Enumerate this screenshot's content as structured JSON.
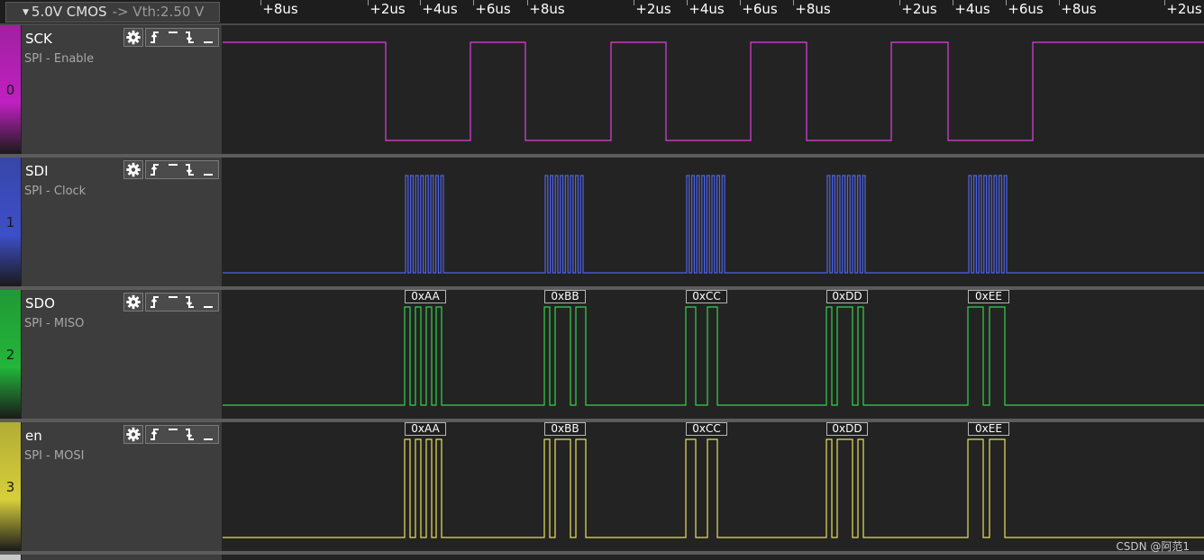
{
  "topbar": {
    "voltage_text": "5.0V CMOS",
    "vth_text": "-> Vth:2.50 V",
    "ruler_labels": [
      "+8us",
      "+2us",
      "+4us",
      "+6us",
      "+8us",
      "+2us",
      "+4us",
      "+6us",
      "+8us",
      "+2us",
      "+4us",
      "+6us",
      "+8us",
      "+2us"
    ]
  },
  "channels": [
    {
      "number": "0",
      "name": "SCK",
      "description": "SPI - Enable",
      "color": "#e040e0",
      "strip_color": "#c020c0",
      "decoded": [],
      "signal_kind": "enable",
      "idle_level": 1
    },
    {
      "number": "1",
      "name": "SDI",
      "description": "SPI - Clock",
      "color": "#4f63e6",
      "strip_color": "#3d4fc9",
      "decoded": [],
      "signal_kind": "clock",
      "idle_level": 0
    },
    {
      "number": "2",
      "name": "SDO",
      "description": "SPI - MISO",
      "color": "#33d44a",
      "strip_color": "#22b63a",
      "decoded": [
        "0xAA",
        "0xBB",
        "0xCC",
        "0xDD",
        "0xEE"
      ],
      "signal_kind": "data",
      "idle_level": 0
    },
    {
      "number": "3",
      "name": "en",
      "description": "SPI - MOSI",
      "color": "#e8e25a",
      "strip_color": "#d6cf3a",
      "decoded": [
        "0xAA",
        "0xBB",
        "0xCC",
        "0xDD",
        "0xEE"
      ],
      "signal_kind": "data",
      "idle_level": 0
    }
  ],
  "icons": {
    "gear": "gear-icon",
    "trigger": [
      "rising-edge-icon",
      "high-level-icon",
      "falling-edge-icon",
      "low-level-icon"
    ]
  },
  "watermark": "CSDN @阿范1"
}
